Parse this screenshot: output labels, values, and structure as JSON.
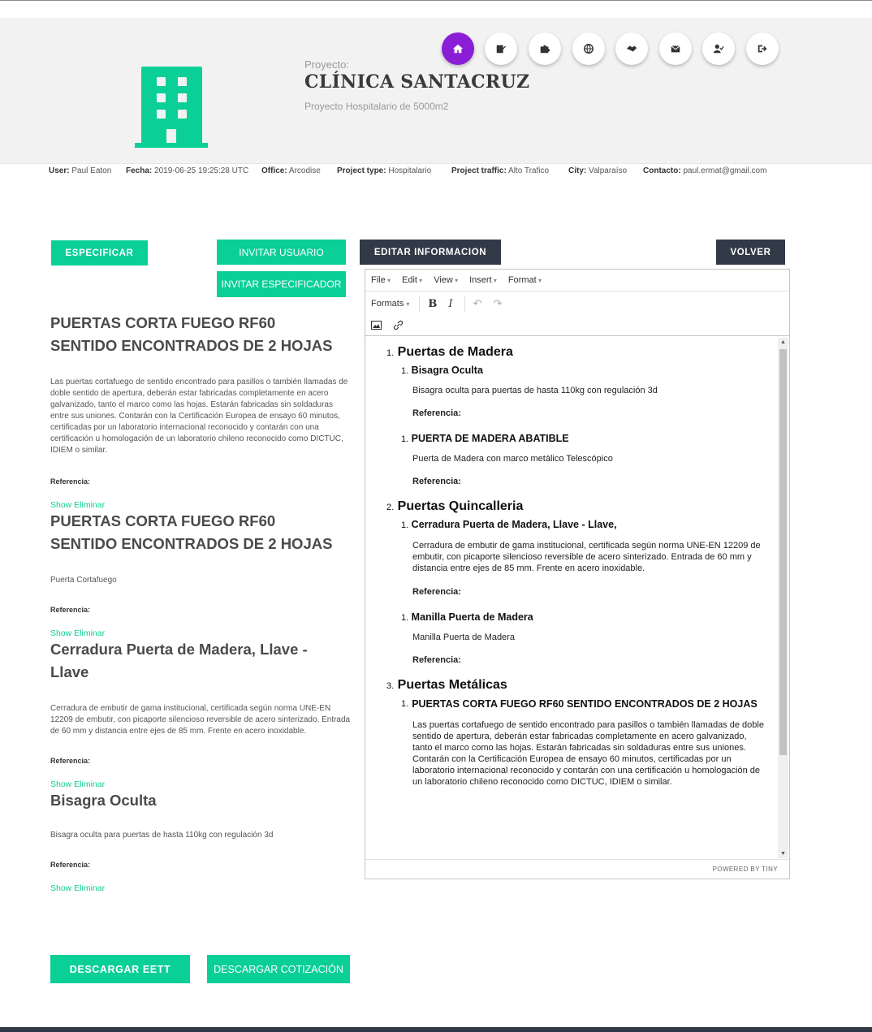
{
  "nav": {
    "icons": [
      "home-icon",
      "edit-icon",
      "puzzle-icon",
      "globe-icon",
      "handshake-icon",
      "mail-icon",
      "user-check-icon",
      "logout-icon"
    ]
  },
  "project": {
    "label": "Proyecto:",
    "title": "CLÍNICA SANTACRUZ",
    "subtitle": "Proyecto Hospitalario de 5000m2"
  },
  "info": {
    "user_label": "User:",
    "user": "Paul Eaton",
    "fecha_label": "Fecha:",
    "fecha": "2019-06-25 19:25:28 UTC",
    "office_label": "Office:",
    "office": "Arcodise",
    "type_label": "Project type:",
    "type": "Hospitalario",
    "traffic_label": "Project traffic:",
    "traffic": "Alto Trafico",
    "city_label": "City:",
    "city": "Valparaíso",
    "contacto_label": "Contacto:",
    "contacto": "paul.ermat@gmail.com"
  },
  "buttons": {
    "especificar": "ESPECIFICAR",
    "invitar_usuario": "INVITAR USUARIO",
    "invitar_especificador": "INVITAR ESPECIFICADOR",
    "editar_informacion": "EDITAR INFORMACION",
    "volver": "VOLVER",
    "descargar_eett": "DESCARGAR EETT",
    "descargar_cotizacion": "DESCARGAR COTIZACIÓN"
  },
  "items": [
    {
      "title_line1": "PUERTAS CORTA FUEGO RF60",
      "title_line2": "SENTIDO ENCONTRADOS DE 2 HOJAS",
      "description": "Las puertas cortafuego de sentido encontrado para pasillos o también llamadas de doble sentido de apertura, deberán estar fabricadas completamente en acero galvanizado, tanto el marco como las hojas. Estarán fabricadas sin soldaduras entre sus uniones. Contarán con la Certificación Europea de ensayo 60 minutos, certificadas por un laboratorio internacional reconocido y contarán con una certificación u homologación de un laboratorio chileno reconocido como DICTUC, IDIEM o similar.",
      "ref": "Referencia:",
      "links": "Show Eliminar"
    },
    {
      "title_line1": "PUERTAS CORTA FUEGO RF60",
      "title_line2": "SENTIDO ENCONTRADOS DE 2 HOJAS",
      "description": "Puerta Cortafuego",
      "ref": "Referencia:",
      "links": "Show Eliminar"
    },
    {
      "title_line1": "Cerradura Puerta de Madera, Llave -",
      "title_line2": "Llave",
      "description": "Cerradura de embutir de gama institucional, certificada según norma UNE-EN 12209 de embutir, con picaporte silencioso reversible de acero sinterizado. Entrada de 60 mm y distancia entre ejes de 85 mm. Frente en acero inoxidable.",
      "ref": "Referencia:",
      "links": "Show Eliminar"
    },
    {
      "title_line1": "Bisagra Oculta",
      "title_line2": "",
      "description": "Bisagra oculta para puertas de hasta 110kg con regulación 3d",
      "ref": "Referencia:",
      "links": "Show Eliminar"
    }
  ],
  "editor": {
    "menu": [
      "File",
      "Edit",
      "View",
      "Insert",
      "Format"
    ],
    "formats": "Formats",
    "bold": "B",
    "italic": "I",
    "powered": "POWERED BY TINY",
    "sections": [
      {
        "num": "1.",
        "title": "Puertas de Madera",
        "entries": [
          {
            "num": "1.",
            "title": "Bisagra Oculta",
            "desc": "Bisagra oculta para puertas de hasta 110kg con regulación 3d",
            "ref": "Referencia:"
          },
          {
            "num": "1.",
            "title": "PUERTA DE MADERA ABATIBLE",
            "desc": "Puerta de Madera con marco metálico Telescópico",
            "ref": "Referencia:"
          }
        ]
      },
      {
        "num": "2.",
        "title": "Puertas Quincalleria",
        "entries": [
          {
            "num": "1.",
            "title": "Cerradura Puerta de Madera, Llave - Llave,",
            "desc": "Cerradura de embutir de gama institucional, certificada según norma UNE-EN 12209 de embutir, con picaporte silencioso reversible de acero sinterizado. Entrada de 60 mm y distancia entre ejes de 85 mm. Frente en acero inoxidable.",
            "ref": "Referencia:"
          },
          {
            "num": "1.",
            "title": "Manilla Puerta de Madera",
            "desc": "Manilla Puerta de Madera",
            "ref": "Referencia:"
          }
        ]
      },
      {
        "num": "3.",
        "title": "Puertas Metálicas",
        "entries": [
          {
            "num": "1.",
            "title": "PUERTAS CORTA FUEGO RF60 SENTIDO ENCONTRADOS DE 2 HOJAS",
            "desc": "Las puertas cortafuego de sentido encontrado para pasillos o también llamadas de doble sentido de apertura, deberán estar fabricadas completamente en acero galvanizado, tanto el marco como las hojas. Estarán fabricadas sin soldaduras entre sus uniones. Contarán con la Certificación Europea de ensayo 60 minutos, certificadas por un laboratorio internacional reconocido y contarán con una certificación u homologación de un laboratorio chileno reconocido como DICTUC, IDIEM o similar.",
            "ref": ""
          }
        ]
      }
    ]
  },
  "colors": {
    "accent": "#0acf97",
    "dark": "#313a46",
    "nav_active": "#8a1ed6"
  }
}
